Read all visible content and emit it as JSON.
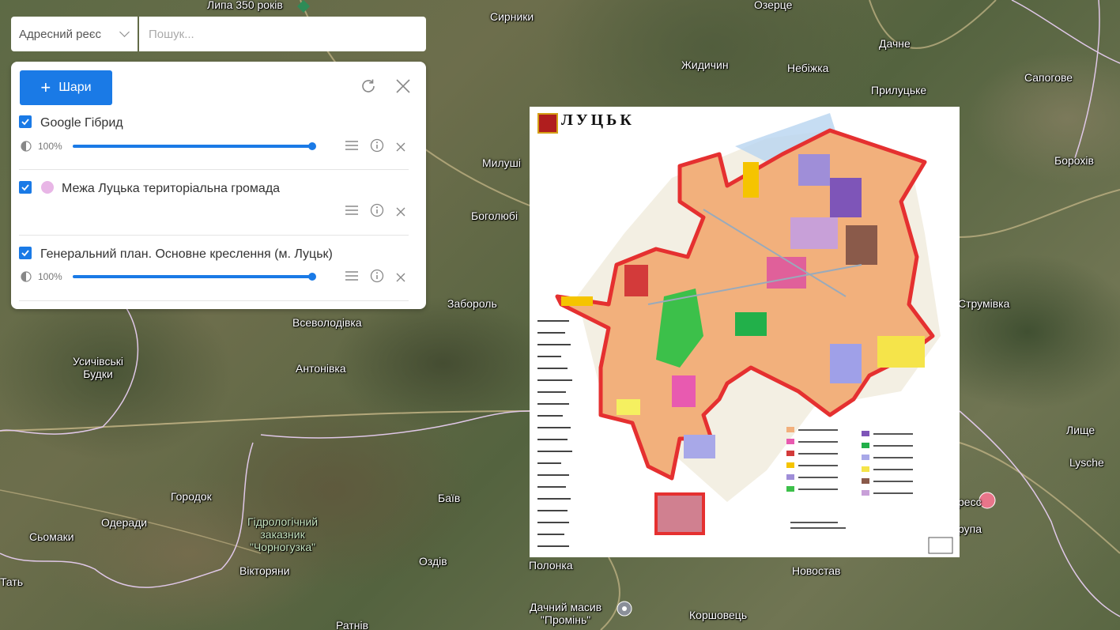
{
  "search": {
    "registry_label": "Адресний реєс",
    "placeholder": "Пошук..."
  },
  "panel": {
    "add_layers_label": "Шари",
    "layers": [
      {
        "name": "Google Гібрид",
        "checked": true,
        "opacity": "100%"
      },
      {
        "name": "Межа Луцька територіальна громада",
        "checked": true,
        "color": "#e8b6e6"
      },
      {
        "name": "Генеральний план. Основне креслення (м. Луцьк)",
        "checked": true,
        "opacity": "100%"
      }
    ]
  },
  "plan": {
    "title": "ЛУЦЬК"
  },
  "map_labels": {
    "lypa": "Липа 350 років",
    "ozertse": "Озерце",
    "syrnyky": "Сирники",
    "zhydychyn": "Жидичин",
    "nebizhka": "Небіжка",
    "dachne": "Дачне",
    "prylutske": "Прилуцьке",
    "sapohove": "Сапогове",
    "milusha": "Милуші",
    "boholiubi": "Боголюбі",
    "borokhiv": "Борохів",
    "zaborol": "Забороль",
    "strumivka": "Струмівка",
    "vsevolodivka": "Всеволодівка",
    "usychivski": "Усичівські\nБудки",
    "antonivka": "Антонівка",
    "lyshche": "Лище",
    "lysche": "Lysche",
    "horodok": "Городок",
    "baiv": "Баїв",
    "oderady": "Одеради",
    "hydro": "Гідрологічний\nзаказник\n\"Чорногузка\"",
    "somaky": "Сьомаки",
    "rupa": "рупа",
    "ress": "ресс",
    "tat": "Тать",
    "viktoriany": "Вікторяни",
    "ozdiv": "Оздів",
    "polonka": "Полонка",
    "novostav": "Новостав",
    "dachnyi": "Дачний масив\n\"Промінь\"",
    "korshovets": "Коршовець",
    "ratniv": "Ратнів"
  }
}
